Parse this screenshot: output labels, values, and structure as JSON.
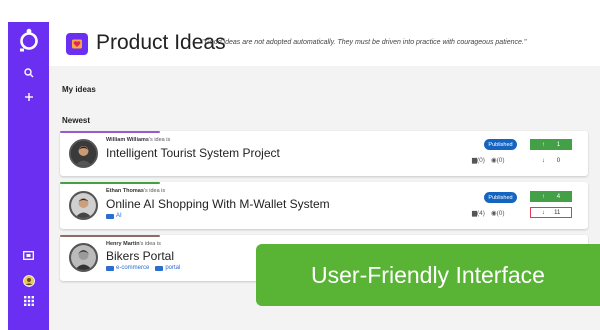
{
  "header": {
    "title": "Product Ideas",
    "quote": "\"Good ideas are not adopted automatically. They must be driven into practice with courageous patience.\""
  },
  "sections": {
    "my_ideas": "My ideas",
    "newest": "Newest"
  },
  "sidebar": {
    "icons": [
      "logo-icon",
      "search-icon",
      "plus-icon",
      "screen-icon",
      "user-avatar",
      "apps-grid-icon"
    ]
  },
  "ideas": [
    {
      "author": "William Williams",
      "author_suffix": "'s idea is",
      "title": "Intelligent Tourist System Project",
      "tags": [],
      "status": "Published",
      "comments": "(0)",
      "views": "(0)",
      "upvotes": "1",
      "downvotes": "0",
      "accent": "#9b59d0"
    },
    {
      "author": "Ethan Thomas",
      "author_suffix": "'s idea is",
      "title": "Online AI Shopping With M-Wallet System",
      "tags": [
        "AI"
      ],
      "status": "Published",
      "comments": "(4)",
      "views": "(0)",
      "upvotes": "4",
      "downvotes": "11",
      "accent": "#43a047"
    },
    {
      "author": "Henry Martin",
      "author_suffix": "'s idea is",
      "title": "Bikers Portal",
      "tags": [
        "e-commerce",
        "portal"
      ],
      "accent": "#8d6e63"
    }
  ],
  "banner": {
    "text": "User-Friendly Interface"
  },
  "colors": {
    "brand": "#6b2ff2",
    "published": "#1565c0",
    "upvote": "#43a047",
    "banner": "#59b436"
  }
}
